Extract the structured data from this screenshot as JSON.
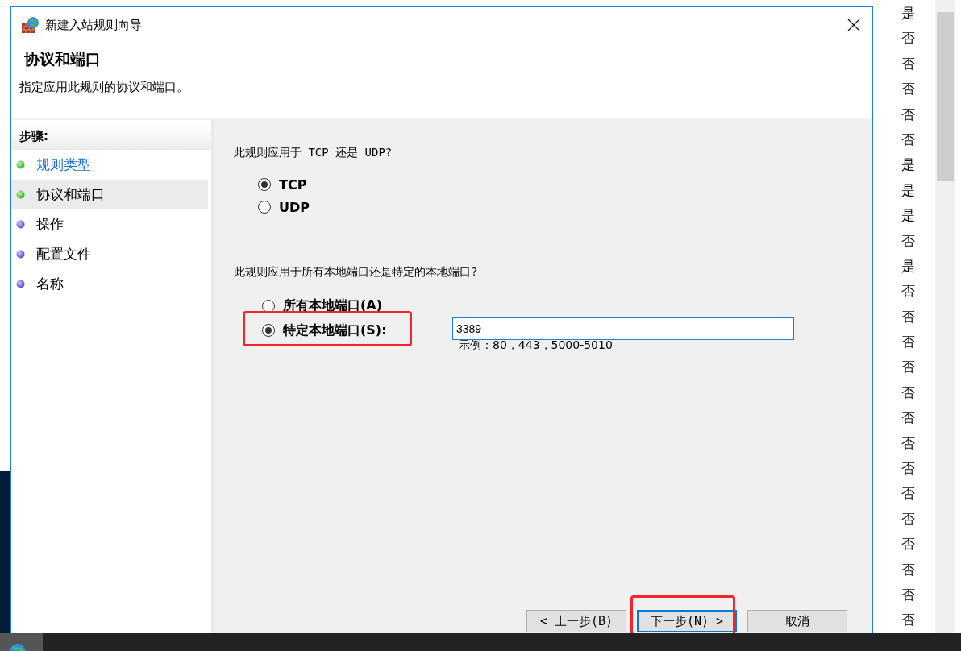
{
  "background_window": {
    "column_values": [
      "是",
      "否",
      "否",
      "否",
      "否",
      "否",
      "是",
      "是",
      "是",
      "否",
      "是",
      "否",
      "否",
      "否",
      "否",
      "否",
      "否",
      "否",
      "否",
      "否",
      "否",
      "否",
      "否",
      "否",
      "否"
    ]
  },
  "dialog": {
    "title": "新建入站规则向导",
    "heading": "协议和端口",
    "subheading": "指定应用此规则的协议和端口。",
    "steps_title": "步骤:",
    "steps": [
      {
        "label": "规则类型",
        "done": true,
        "selected": false
      },
      {
        "label": "协议和端口",
        "done": true,
        "selected": true
      },
      {
        "label": "操作",
        "done": false,
        "selected": false
      },
      {
        "label": "配置文件",
        "done": false,
        "selected": false
      },
      {
        "label": "名称",
        "done": false,
        "selected": false
      }
    ],
    "protocol_question": "此规则应用于 TCP 还是 UDP?",
    "protocol_options": [
      {
        "label": "TCP",
        "selected": true
      },
      {
        "label": "UDP",
        "selected": false
      }
    ],
    "port_question": "此规则应用于所有本地端口还是特定的本地端口?",
    "port_options": [
      {
        "label": "所有本地端口(A)",
        "selected": false,
        "highlighted": false
      },
      {
        "label": "特定本地端口(S):",
        "selected": true,
        "highlighted": true
      }
    ],
    "port_field": {
      "value": "3389"
    },
    "port_example": "示例：80，443，5000-5010",
    "buttons": [
      {
        "label": "< 上一步(B)",
        "focused": false,
        "highlighted": false
      },
      {
        "label": "下一步(N) >",
        "focused": true,
        "highlighted": true
      },
      {
        "label": "取消",
        "focused": false,
        "highlighted": false
      }
    ]
  }
}
